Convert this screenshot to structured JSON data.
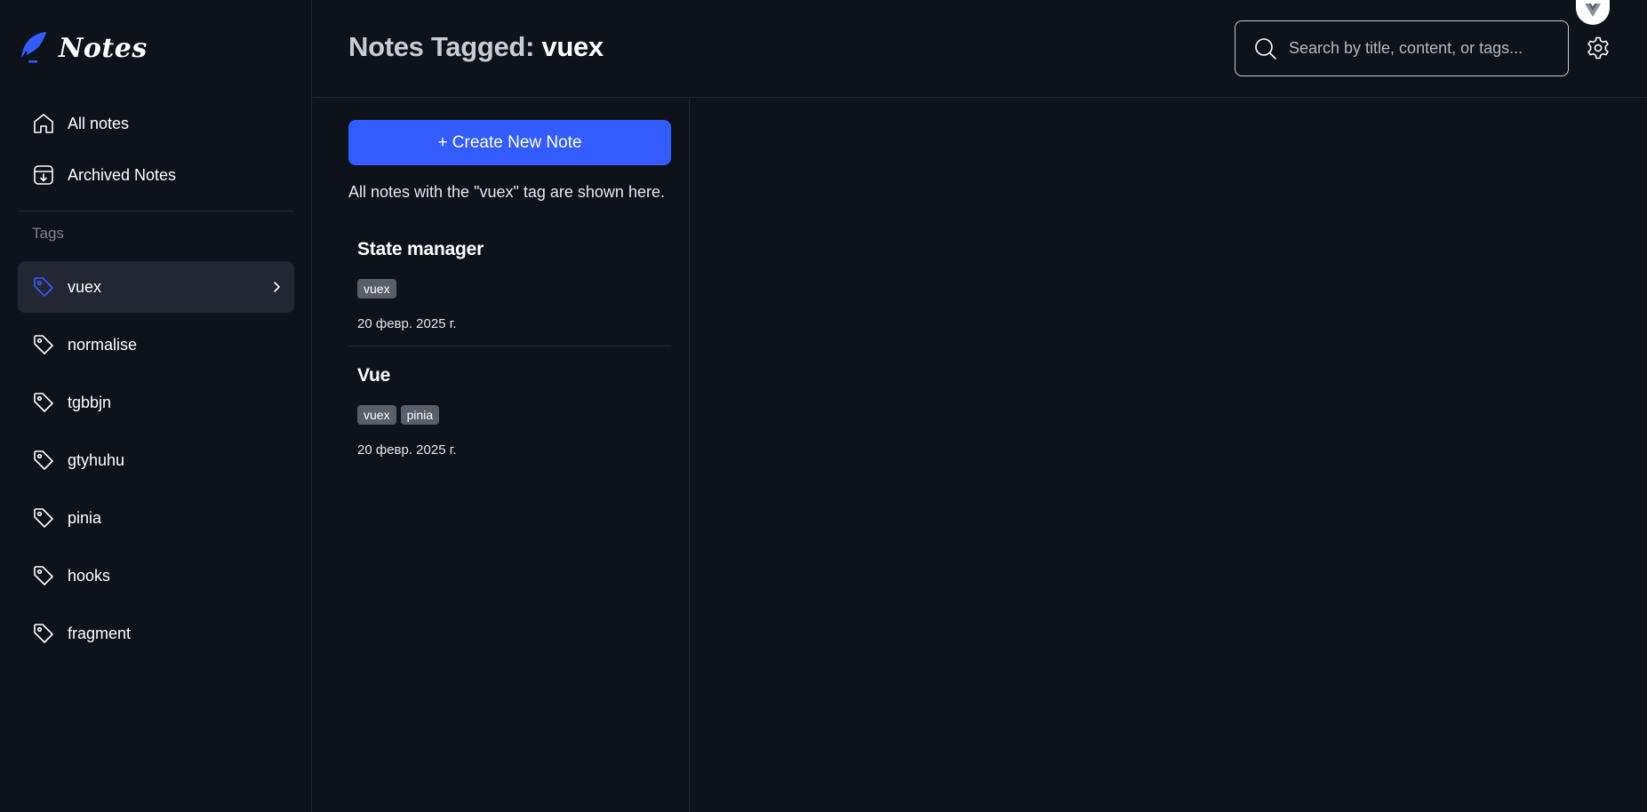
{
  "app": {
    "name": "Notes"
  },
  "sidebar": {
    "nav": [
      {
        "label": "All notes",
        "icon": "home-icon"
      },
      {
        "label": "Archived Notes",
        "icon": "archive-icon"
      }
    ],
    "tags_label": "Tags",
    "tags": [
      {
        "label": "vuex",
        "active": true
      },
      {
        "label": "normalise",
        "active": false
      },
      {
        "label": "tgbbjn",
        "active": false
      },
      {
        "label": "gtyhuhu",
        "active": false
      },
      {
        "label": "pinia",
        "active": false
      },
      {
        "label": "hooks",
        "active": false
      },
      {
        "label": "fragment",
        "active": false
      }
    ]
  },
  "header": {
    "title_prefix": "Notes Tagged: ",
    "title_tag": "vuex",
    "search_placeholder": "Search by title, content, or tags..."
  },
  "notes_panel": {
    "create_label": "+ Create New Note",
    "description": "All notes with the \"vuex\" tag are shown here.",
    "notes": [
      {
        "title": "State manager",
        "tags": [
          "vuex"
        ],
        "date": "20 февр. 2025 г."
      },
      {
        "title": "Vue",
        "tags": [
          "vuex",
          "pinia"
        ],
        "date": "20 февр. 2025 г."
      }
    ]
  },
  "colors": {
    "background": "#0e121b",
    "accent": "#335cff",
    "active_tag_bg": "#232633",
    "chip_bg": "#5a5e6a"
  }
}
